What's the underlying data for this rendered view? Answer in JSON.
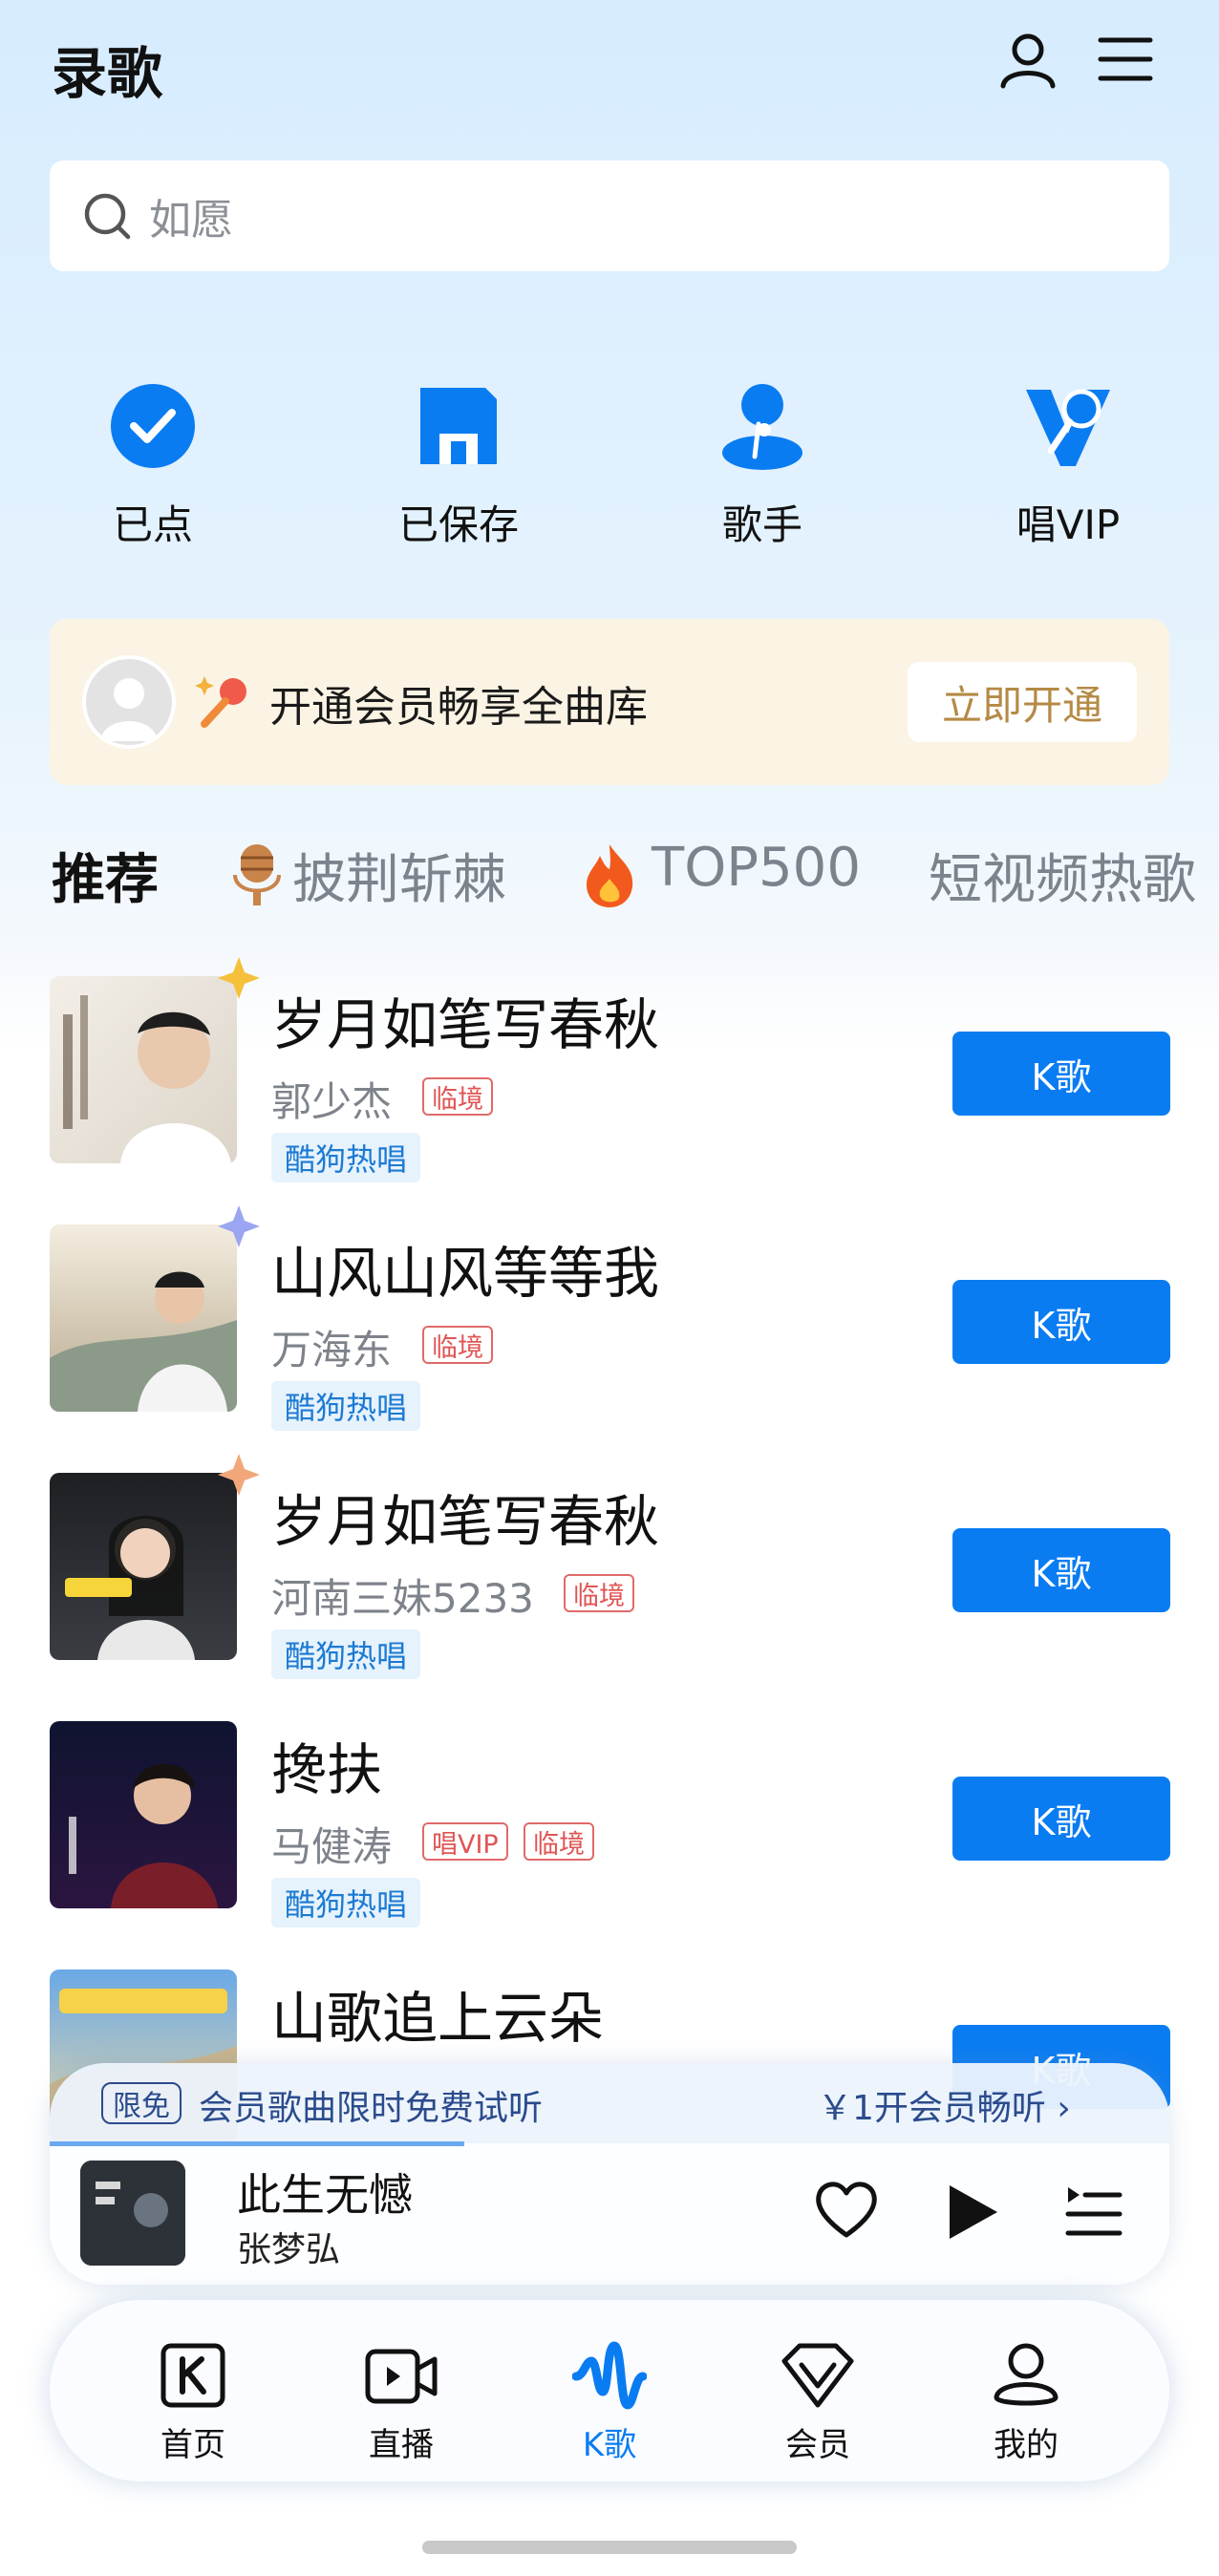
{
  "header": {
    "title": "录歌",
    "profile_icon": "user-icon",
    "menu_icon": "menu-icon"
  },
  "search": {
    "placeholder": "如愿"
  },
  "quick_actions": [
    {
      "label": "已点",
      "icon": "check-circle-icon"
    },
    {
      "label": "已保存",
      "icon": "save-icon"
    },
    {
      "label": "歌手",
      "icon": "singer-icon"
    },
    {
      "label": "唱VIP",
      "icon": "vip-mic-icon"
    }
  ],
  "vip_banner": {
    "text": "开通会员畅享全曲库",
    "button": "立即开通"
  },
  "tabs": [
    {
      "label": "推荐",
      "active": true
    },
    {
      "label": "披荆斩棘",
      "icon": "microphone-icon"
    },
    {
      "label": "TOP500",
      "icon": "fire-icon"
    },
    {
      "label": "短视频热歌"
    }
  ],
  "songs": [
    {
      "title": "岁月如笔写春秋",
      "artist": "郭少杰",
      "tags": [
        "临境"
      ],
      "hot": "酷狗热唱",
      "button": "K歌"
    },
    {
      "title": "山风山风等等我",
      "artist": "万海东",
      "tags": [
        "临境"
      ],
      "hot": "酷狗热唱",
      "button": "K歌"
    },
    {
      "title": "岁月如笔写春秋",
      "artist": "河南三妹5233",
      "tags": [
        "临境"
      ],
      "hot": "酷狗热唱",
      "button": "K歌"
    },
    {
      "title": "搀扶",
      "artist": "马健涛",
      "tags": [
        "唱VIP",
        "临境"
      ],
      "hot": "酷狗热唱",
      "button": "K歌"
    },
    {
      "title": "山歌追上云朵",
      "button": "K歌"
    }
  ],
  "promo": {
    "badge": "限免",
    "text": "会员歌曲限时免费试听",
    "right": "￥1开会员畅听 ›"
  },
  "player": {
    "title": "此生无憾",
    "artist": "张梦弘",
    "progress": 0.37
  },
  "nav": [
    {
      "label": "首页",
      "icon": "home-k-icon"
    },
    {
      "label": "直播",
      "icon": "live-icon"
    },
    {
      "label": "K歌",
      "icon": "wave-icon",
      "active": true
    },
    {
      "label": "会员",
      "icon": "vip-diamond-icon"
    },
    {
      "label": "我的",
      "icon": "profile-icon"
    }
  ],
  "colors": {
    "accent": "#0a7cf2",
    "tag_red": "#e05555",
    "hot_blue": "#1c7ad3",
    "vip_gold": "#b58a45"
  }
}
